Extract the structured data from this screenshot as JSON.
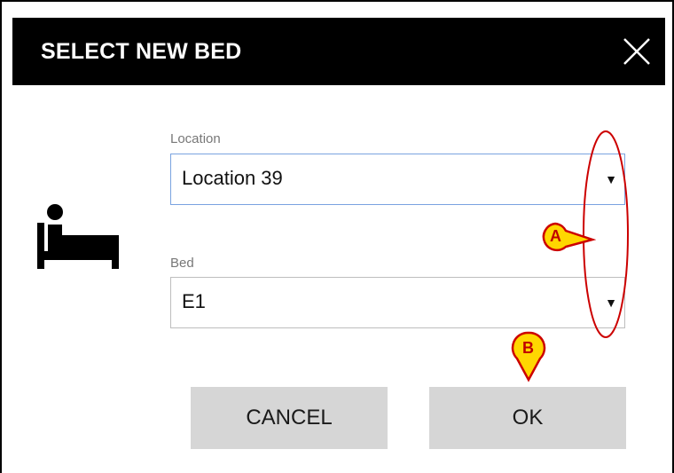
{
  "dialog": {
    "title": "SELECT NEW BED",
    "close_icon": "close-icon"
  },
  "location": {
    "label": "Location",
    "value": "Location 39",
    "arrow": "▼"
  },
  "bed": {
    "label": "Bed",
    "value": "E1",
    "arrow": "▼"
  },
  "buttons": {
    "cancel": "CANCEL",
    "ok": "OK"
  },
  "icons": {
    "bed": "bed-person-icon"
  },
  "annotations": {
    "a": "A",
    "b": "B"
  },
  "colors": {
    "titlebar": "#000000",
    "button_bg": "#d6d6d6",
    "focus_border": "#7aa3e0",
    "annotation_red": "#cc0000",
    "marker_yellow": "#ffd700"
  }
}
